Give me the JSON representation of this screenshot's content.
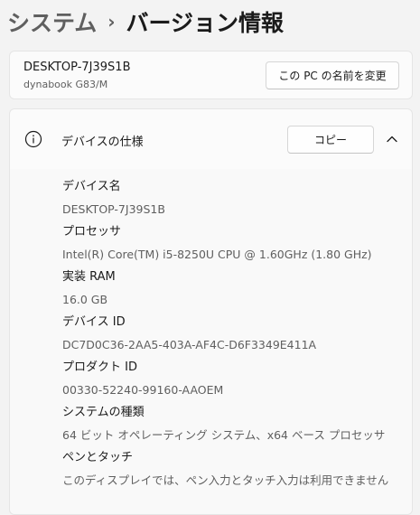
{
  "breadcrumb": {
    "parent": "システム",
    "separator": "›",
    "current": "バージョン情報"
  },
  "device": {
    "name": "DESKTOP-7J39S1B",
    "model": "dynabook G83/M",
    "rename_button": "この PC の名前を変更"
  },
  "specs": {
    "title": "デバイスの仕様",
    "copy_button": "コピー",
    "expanded": true,
    "items": [
      {
        "label": "デバイス名",
        "value": "DESKTOP-7J39S1B"
      },
      {
        "label": "プロセッサ",
        "value": "Intel(R) Core(TM) i5-8250U CPU @ 1.60GHz (1.80 GHz)"
      },
      {
        "label": "実装 RAM",
        "value": "16.0 GB"
      },
      {
        "label": "デバイス ID",
        "value": "DC7D0C36-2AA5-403A-AF4C-D6F3349E411A"
      },
      {
        "label": "プロダクト ID",
        "value": "00330-52240-99160-AAOEM"
      },
      {
        "label": "システムの種類",
        "value": "64 ビット オペレーティング システム、x64 ベース プロセッサ"
      },
      {
        "label": "ペンとタッチ",
        "value": "このディスプレイでは、ペン入力とタッチ入力は利用できません"
      }
    ]
  },
  "icons": {
    "info": "info-circle-icon",
    "collapse": "chevron-up-icon"
  },
  "colors": {
    "background": "#f3f3f3",
    "card": "#fbfbfb",
    "secondary_text": "#5f5f5f"
  }
}
